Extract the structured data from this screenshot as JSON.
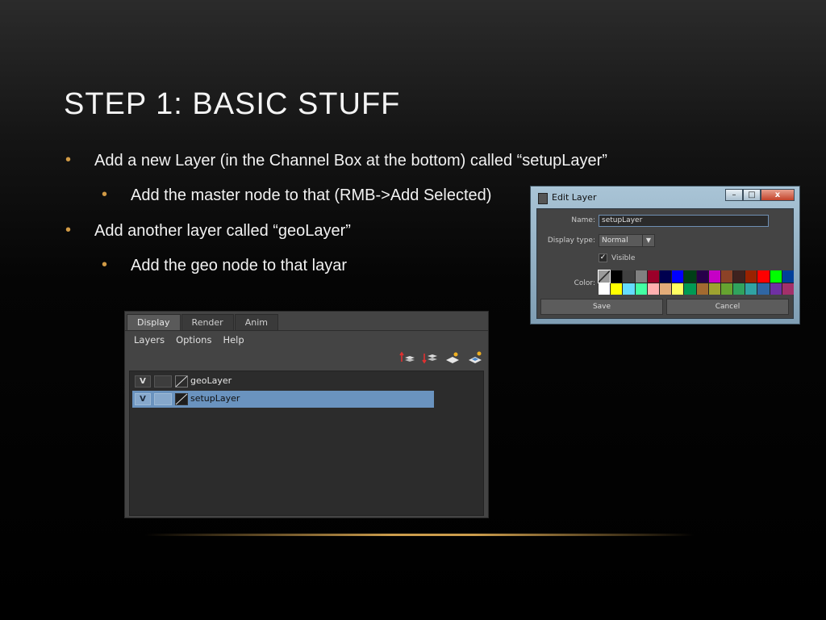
{
  "slide": {
    "title": "STEP 1: BASIC STUFF",
    "bullets": [
      {
        "level": 1,
        "text": "Add a new Layer (in the Channel Box at the bottom) called “setupLayer”"
      },
      {
        "level": 2,
        "text": "Add the master node to that (RMB->Add Selected)"
      },
      {
        "level": 1,
        "text": "Add another layer called “geoLayer”"
      },
      {
        "level": 2,
        "text": "Add the geo node to that layar"
      }
    ],
    "bullet_glyph": "•",
    "accent_color": "#d19a45"
  },
  "layer_editor": {
    "tabs": [
      "Display",
      "Render",
      "Anim"
    ],
    "active_tab": "Display",
    "menu": [
      "Layers",
      "Options",
      "Help"
    ],
    "tool_icons": [
      "move-layer-up-icon",
      "move-layer-down-icon",
      "create-empty-layer-icon",
      "create-layer-from-selected-icon"
    ],
    "layers": [
      {
        "visible": "V",
        "name": "geoLayer",
        "selected": false
      },
      {
        "visible": "V",
        "name": "setupLayer",
        "selected": true
      }
    ],
    "selection_color": "#6a93bf"
  },
  "edit_layer_dialog": {
    "title": "Edit Layer",
    "window_buttons": {
      "minimize": "–",
      "maximize": "□",
      "close": "x"
    },
    "name_label": "Name:",
    "name_value": "setupLayer",
    "display_type_label": "Display type:",
    "display_type_value": "Normal",
    "visible_label": "Visible",
    "visible_checked": "✓",
    "color_label": "Color:",
    "colors": [
      "#9a9a9a",
      "#000000",
      "#404040",
      "#808080",
      "#9b0029",
      "#00004f",
      "#0000ff",
      "#003f17",
      "#26004a",
      "#c600c6",
      "#8c4227",
      "#3f221f",
      "#9a2200",
      "#ff0000",
      "#00ff00",
      "#003f9a",
      "#ffffff",
      "#ffff00",
      "#64dcff",
      "#43ffa3",
      "#ffafaf",
      "#e3ac79",
      "#ffff62",
      "#009a54",
      "#a36a30",
      "#9ea330",
      "#66a330",
      "#30a35d",
      "#30a3a3",
      "#3066a3",
      "#6f30a3",
      "#a3306a"
    ],
    "save_label": "Save",
    "cancel_label": "Cancel"
  }
}
